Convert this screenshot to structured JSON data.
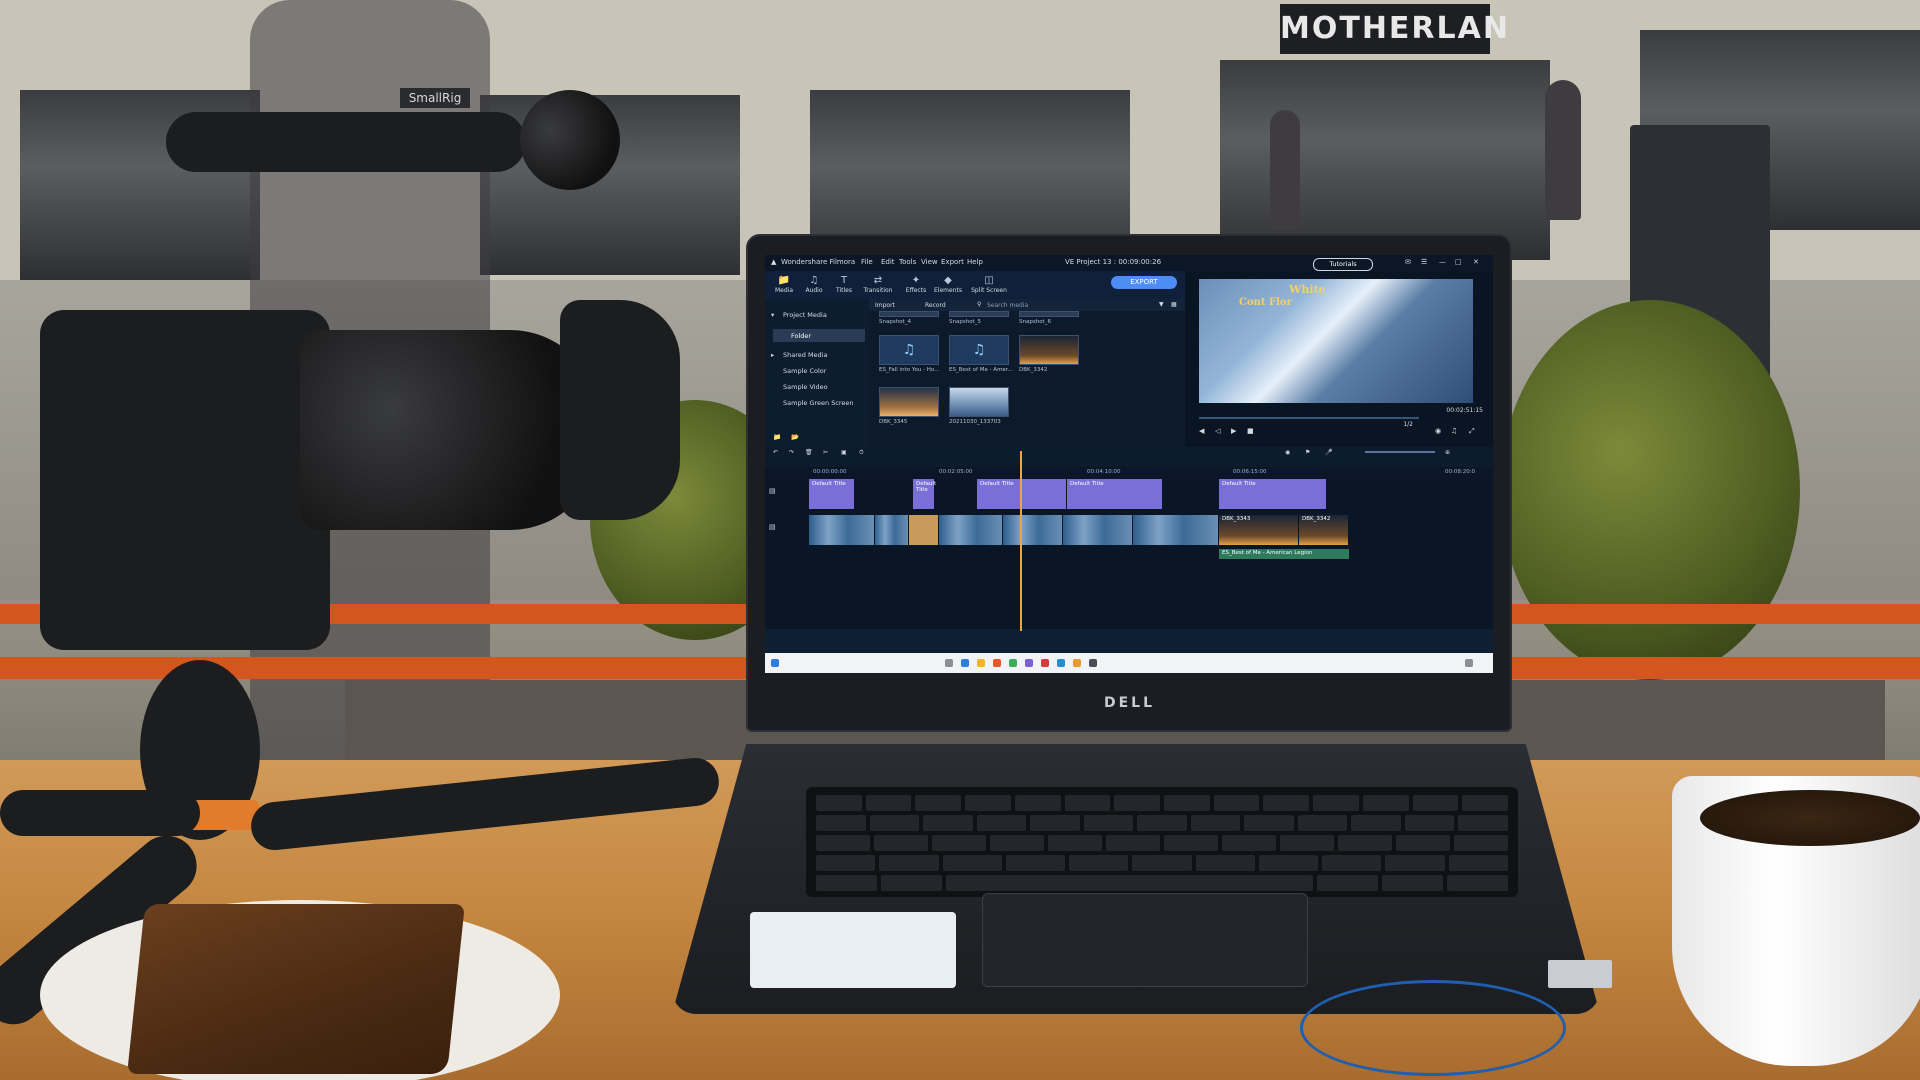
{
  "scene": {
    "shop_sign": "MOTHERLAN",
    "camera_brand": "SmallRig",
    "laptop_brand": "DELL"
  },
  "app": {
    "title": "Wondershare Filmora",
    "menu": [
      "File",
      "Edit",
      "Tools",
      "View",
      "Export",
      "Help"
    ],
    "project_title": "VE Project 13 : 00:09:00:26",
    "tutorials_label": "Tutorials",
    "export_label": "EXPORT",
    "toolbar": [
      {
        "label": "Media",
        "icon": "folder-icon"
      },
      {
        "label": "Audio",
        "icon": "music-note-icon"
      },
      {
        "label": "Titles",
        "icon": "text-t-icon"
      },
      {
        "label": "Transition",
        "icon": "transition-icon"
      },
      {
        "label": "Effects",
        "icon": "effects-icon"
      },
      {
        "label": "Elements",
        "icon": "elements-icon"
      },
      {
        "label": "Split Screen",
        "icon": "split-screen-icon"
      }
    ],
    "sidebar": {
      "project_media": "Project Media",
      "folder": "Folder",
      "shared_media": "Shared Media",
      "items": [
        "Sample Color",
        "Sample Video",
        "Sample Green Screen"
      ]
    },
    "media_bar": {
      "import": "Import",
      "record": "Record",
      "search_placeholder": "Search media"
    },
    "media_items": [
      {
        "label": "Snapshot_4",
        "kind": "video"
      },
      {
        "label": "Snapshot_5",
        "kind": "video"
      },
      {
        "label": "Snapshot_6",
        "kind": "video"
      },
      {
        "label": "ES_Fall into You - Ho...",
        "kind": "audio"
      },
      {
        "label": "ES_Best of Me - Amer...",
        "kind": "audio"
      },
      {
        "label": "DBK_3342",
        "kind": "video"
      },
      {
        "label": "DBK_3345",
        "kind": "video"
      },
      {
        "label": "20211030_133703",
        "kind": "video"
      }
    ],
    "preview": {
      "title_line1": "White",
      "title_line2": "Cont Flor",
      "timecode": "00:02:51:15",
      "page": "1/2"
    },
    "timeline": {
      "ruler": [
        "00:00:00:00",
        "00:02:05:00",
        "00:04:10:00",
        "00:06:15:00",
        "00:08:20:0"
      ],
      "title_clips": [
        "Default Title",
        "Default Title",
        "Default Title",
        "Default Title",
        "Default Title"
      ],
      "video_labels": [
        "DBK_3343",
        "DBK_3342"
      ],
      "audio_label": "ES_Best of Me - American Legion"
    }
  }
}
